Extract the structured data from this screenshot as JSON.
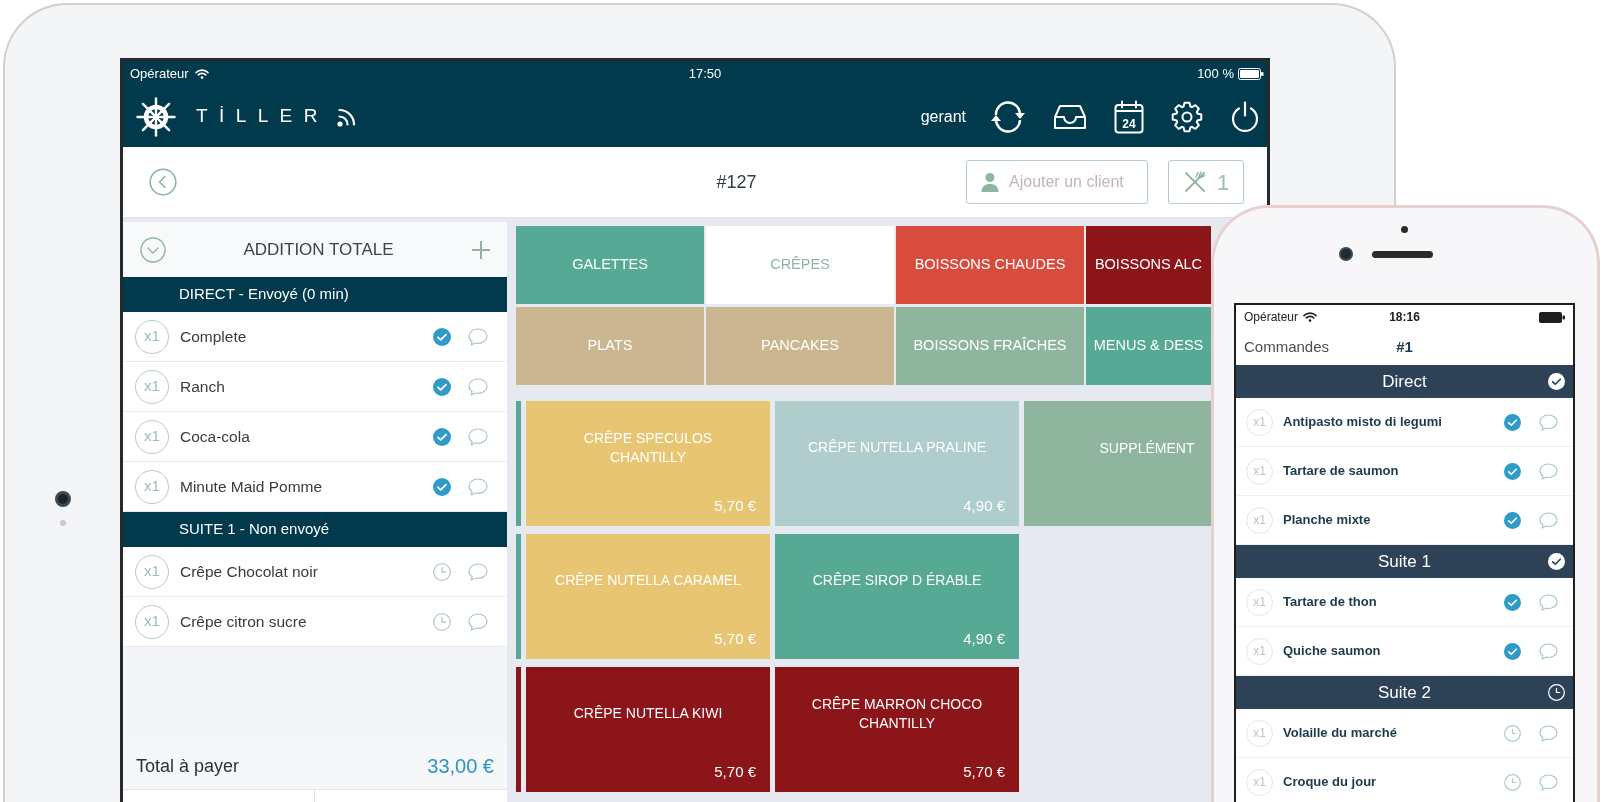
{
  "tablet": {
    "status_bar": {
      "carrier": "Opérateur",
      "time": "17:50",
      "battery": "100 %"
    },
    "app_bar": {
      "logo": "TİLLER",
      "user": "gerant",
      "calendar_day": "24"
    },
    "order_bar": {
      "title": "#127",
      "client_button": "Ajouter un client",
      "covers": "1"
    },
    "order_panel": {
      "title": "ADDITION TOTALE",
      "groups": [
        {
          "title": "DIRECT - Envoyé (0 min)",
          "items": [
            {
              "quantity": "x1",
              "name": "Complete",
              "sent": true
            },
            {
              "quantity": "x1",
              "name": "Ranch",
              "sent": true
            },
            {
              "quantity": "x1",
              "name": "Coca-cola",
              "sent": true
            },
            {
              "quantity": "x1",
              "name": "Minute Maid Pomme",
              "sent": true
            }
          ]
        },
        {
          "title": "SUITE 1 - Non envoyé",
          "items": [
            {
              "quantity": "x1",
              "name": "Crêpe Chocolat noir",
              "sent": false
            },
            {
              "quantity": "x1",
              "name": "Crêpe citron sucre",
              "sent": false
            }
          ]
        }
      ],
      "total_label": "Total à payer",
      "total": "33,00 €"
    },
    "categories": [
      {
        "label": "GALETTES",
        "selected": false,
        "color": "#56a992"
      },
      {
        "label": "CRÊPES",
        "selected": true,
        "color": "#8fb5a0"
      },
      {
        "label": "BOISSONS CHAUDES",
        "selected": false,
        "color": "#d84c3e"
      },
      {
        "label": "BOISSONS ALC",
        "selected": false,
        "color": "#8b1519"
      },
      {
        "label": "PLATS",
        "selected": false,
        "color": "#cbb692"
      },
      {
        "label": "PANCAKES",
        "selected": false,
        "color": "#cbb692"
      },
      {
        "label": "BOISSONS FRAÎCHES",
        "selected": false,
        "color": "#8fb59e"
      },
      {
        "label": "MENUS & DESS",
        "selected": false,
        "color": "#56a992"
      }
    ],
    "product_rows": [
      {
        "color": "#56a992",
        "items": [
          {
            "name": "CRÊPE SPECULOS CHANTILLY",
            "price": "5,70 €",
            "color": "#e8c572"
          },
          {
            "name": "CRÊPE NUTELLA PRALINE",
            "price": "4,90 €",
            "color": "#afcdcc"
          },
          {
            "name": "SUPPLÉMENT",
            "color": "#8fb59e"
          }
        ]
      },
      {
        "color": "#56a992",
        "items": [
          {
            "name": "CRÊPE NUTELLA CARAMEL",
            "price": "5,70 €",
            "color": "#e8c572"
          },
          {
            "name": "CRÊPE SIROP D ÉRABLE",
            "price": "4,90 €",
            "color": "#56a992"
          }
        ]
      },
      {
        "color": "#8b1519",
        "items": [
          {
            "name": "CRÊPE NUTELLA KIWI",
            "price": "5,70 €",
            "color": "#8b1519"
          },
          {
            "name": "CRÊPE MARRON CHOCO CHANTILLY",
            "price": "5,70 €",
            "color": "#8b1519"
          }
        ]
      }
    ]
  },
  "phone": {
    "status_bar": {
      "carrier": "Opérateur",
      "time": "18:16"
    },
    "nav": {
      "back": "Commandes",
      "title": "#1"
    },
    "groups": [
      {
        "title": "Direct",
        "done": true,
        "items": [
          {
            "quantity": "x1",
            "name": "Antipasto misto di legumi",
            "sent": true
          },
          {
            "quantity": "x1",
            "name": "Tartare de saumon",
            "sent": true
          },
          {
            "quantity": "x1",
            "name": "Planche mixte",
            "sent": true
          }
        ]
      },
      {
        "title": "Suite 1",
        "done": true,
        "items": [
          {
            "quantity": "x1",
            "name": "Tartare de thon",
            "sent": true
          },
          {
            "quantity": "x1",
            "name": "Quiche saumon",
            "sent": true
          }
        ]
      },
      {
        "title": "Suite 2",
        "done": false,
        "items": [
          {
            "quantity": "x1",
            "name": "Volaille du marché",
            "sent": false
          },
          {
            "quantity": "x1",
            "name": "Croque du jour",
            "sent": false
          }
        ]
      }
    ]
  }
}
